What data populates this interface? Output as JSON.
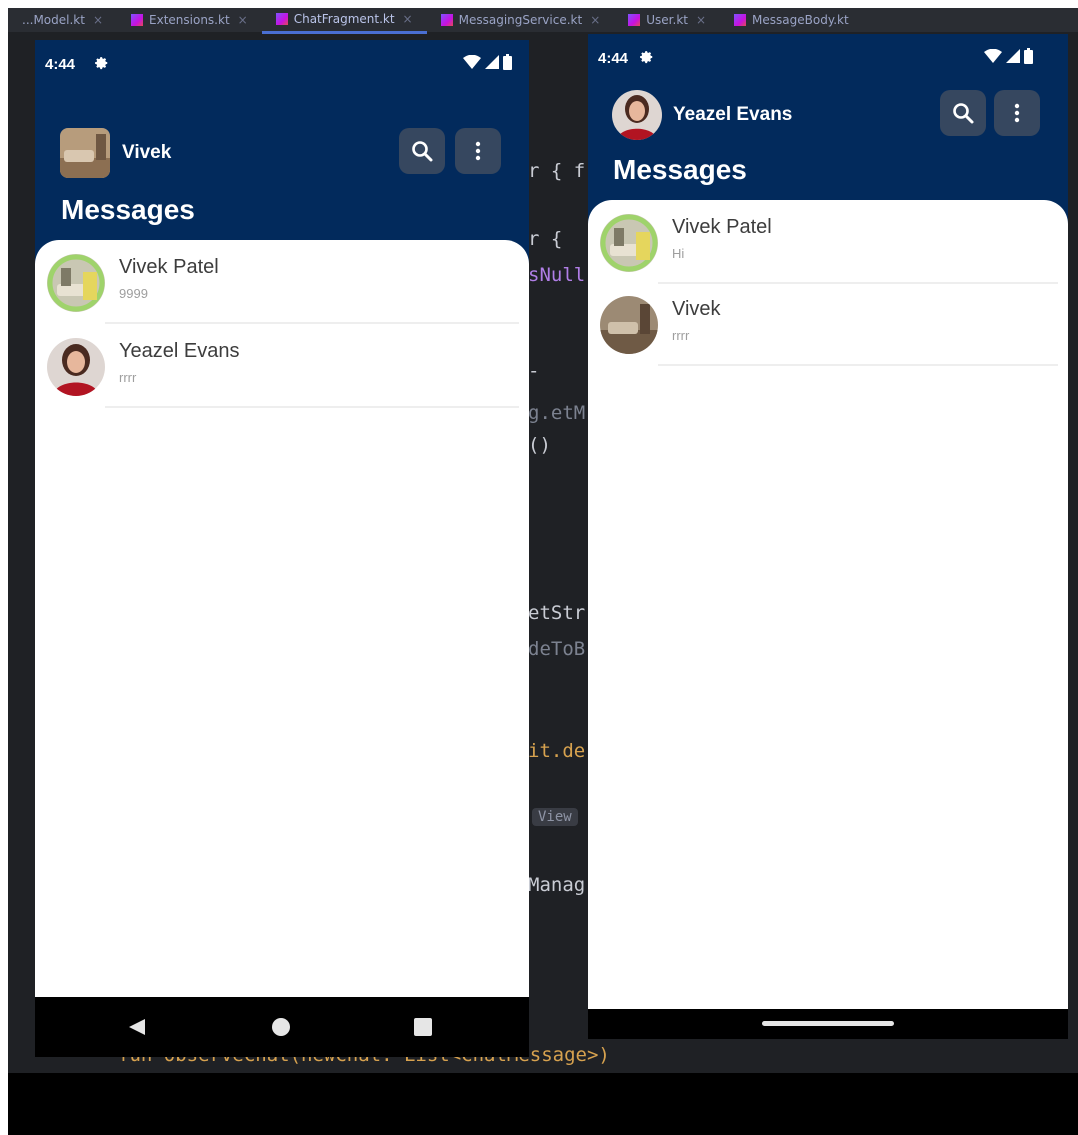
{
  "ide": {
    "tabs": [
      "...Model.kt",
      "Extensions.kt",
      "ChatFragment.kt",
      "MessagingService.kt",
      "User.kt",
      "MessageBody.kt"
    ],
    "code_fragments": [
      "r { f",
      "r {",
      "sNull",
      "-",
      "g.etM",
      "()",
      "etStr",
      "deToB",
      "it.de",
      "View",
      "Manag",
      "fun observeChat(newChat: List<ChatMessage>)"
    ]
  },
  "left_phone": {
    "status_time": "4:44",
    "profile_name": "Vivek",
    "title": "Messages",
    "chats": [
      {
        "name": "Vivek Patel",
        "preview": "9999"
      },
      {
        "name": "Yeazel Evans",
        "preview": "rrrr"
      }
    ]
  },
  "right_phone": {
    "status_time": "4:44",
    "profile_name": "Yeazel Evans",
    "title": "Messages",
    "chats": [
      {
        "name": "Vivek Patel",
        "preview": "Hi"
      },
      {
        "name": "Vivek",
        "preview": "rrrr"
      }
    ]
  },
  "colors": {
    "header": "#022a5c",
    "button": "#36475f",
    "ide_background": "#1f2125"
  },
  "icons": [
    "settings-icon",
    "wifi-icon",
    "signal-icon",
    "battery-icon",
    "search-icon",
    "more-vert-icon",
    "back-icon",
    "home-icon",
    "recents-icon"
  ]
}
